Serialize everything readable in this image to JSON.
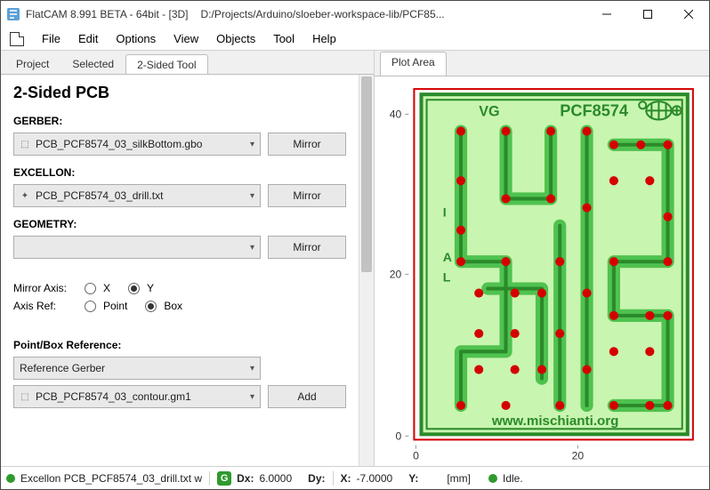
{
  "title": {
    "app": "FlatCAM 8.991 BETA - 64bit - [3D]",
    "path": "D:/Projects/Arduino/sloeber-workspace-lib/PCF85..."
  },
  "menus": [
    "File",
    "Edit",
    "Options",
    "View",
    "Objects",
    "Tool",
    "Help"
  ],
  "left_tabs": [
    "Project",
    "Selected",
    "2-Sided Tool"
  ],
  "left_active": 2,
  "right_tab": "Plot Area",
  "tool": {
    "title": "2-Sided PCB",
    "sections": {
      "gerber": {
        "label": "GERBER:",
        "value": "PCB_PCF8574_03_silkBottom.gbo",
        "btn": "Mirror"
      },
      "excellon": {
        "label": "EXCELLON:",
        "value": "PCB_PCF8574_03_drill.txt",
        "btn": "Mirror"
      },
      "geometry": {
        "label": "GEOMETRY:",
        "value": "",
        "btn": "Mirror"
      }
    },
    "mirror_axis": {
      "label": "Mirror Axis:",
      "options": [
        "X",
        "Y"
      ],
      "selected": "Y"
    },
    "axis_ref": {
      "label": "Axis Ref:",
      "options": [
        "Point",
        "Box"
      ],
      "selected": "Box"
    },
    "ref_section": {
      "label": "Point/Box Reference:",
      "type_value": "Reference Gerber",
      "obj_value": "PCB_PCF8574_03_contour.gm1",
      "add_btn": "Add"
    }
  },
  "plot": {
    "y_ticks": [
      "40",
      "20",
      "0"
    ],
    "x_ticks": [
      "0",
      "20"
    ],
    "silktext": {
      "vg": "VG",
      "part": "PCF8574",
      "i": "I",
      "a": "A",
      "l": "L",
      "url": "www.mischianti.org"
    }
  },
  "status": {
    "msg": "Excellon PCB_PCF8574_03_drill.txt w",
    "g_badge": "G",
    "dx_label": "Dx:",
    "dx": "6.0000",
    "dy_label": "Dy:",
    "x_label": "X:",
    "x": "-7.0000",
    "y_label": "Y:",
    "units": "[mm]",
    "idle": "Idle."
  }
}
